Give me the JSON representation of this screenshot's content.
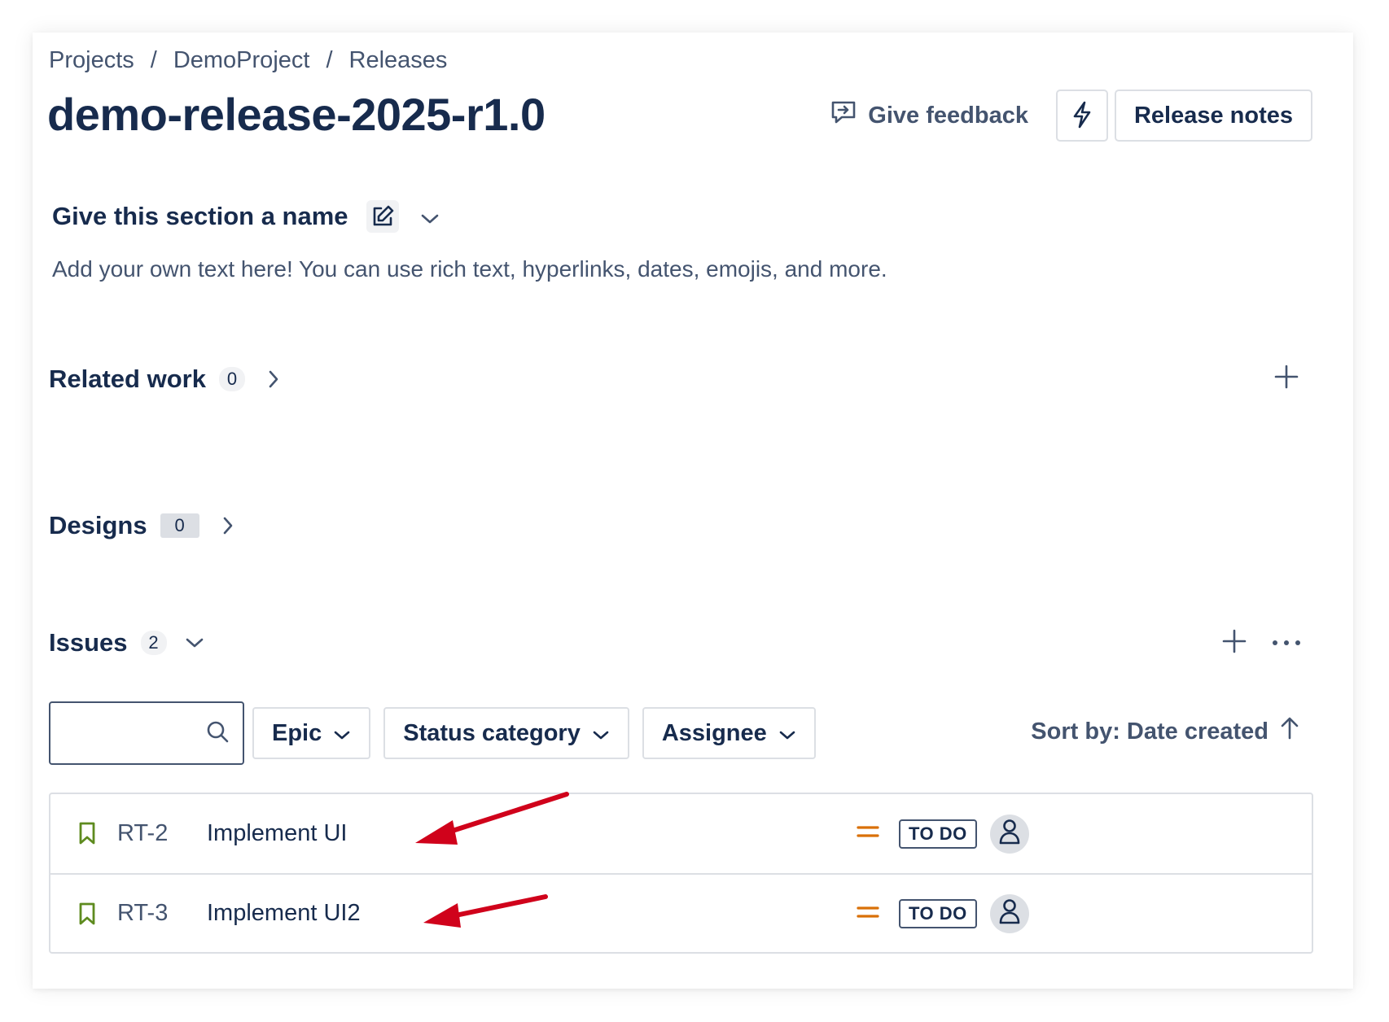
{
  "breadcrumb": [
    {
      "label": "Projects"
    },
    {
      "label": "DemoProject"
    },
    {
      "label": "Releases"
    }
  ],
  "breadcrumb_separator": "/",
  "title": "demo-release-2025-r1.0",
  "header": {
    "feedback_label": "Give feedback",
    "release_notes_label": "Release notes"
  },
  "section": {
    "name": "Give this section a name",
    "description": "Add your own text here! You can use rich text, hyperlinks, dates, emojis, and more."
  },
  "related_work": {
    "label": "Related work",
    "count": "0"
  },
  "designs": {
    "label": "Designs",
    "count": "0"
  },
  "issues": {
    "label": "Issues",
    "count": "2",
    "filters": {
      "search_placeholder": "",
      "epic": "Epic",
      "status_category": "Status category",
      "assignee": "Assignee"
    },
    "sort_label": "Sort by: Date created",
    "rows": [
      {
        "key": "RT-2",
        "summary": "Implement UI",
        "status": "TO DO"
      },
      {
        "key": "RT-3",
        "summary": "Implement UI2",
        "status": "TO DO"
      }
    ]
  },
  "colors": {
    "story_icon": "#5e8b1f",
    "priority_medium": "#d97008",
    "annotation_arrow": "#d0021b"
  },
  "icons": {
    "feedback": "feedback-icon",
    "bolt": "lightning-bolt-icon",
    "edit": "edit-icon",
    "search": "search-icon",
    "story": "bookmark-icon",
    "priority": "priority-medium-icon",
    "avatar": "person-icon"
  }
}
